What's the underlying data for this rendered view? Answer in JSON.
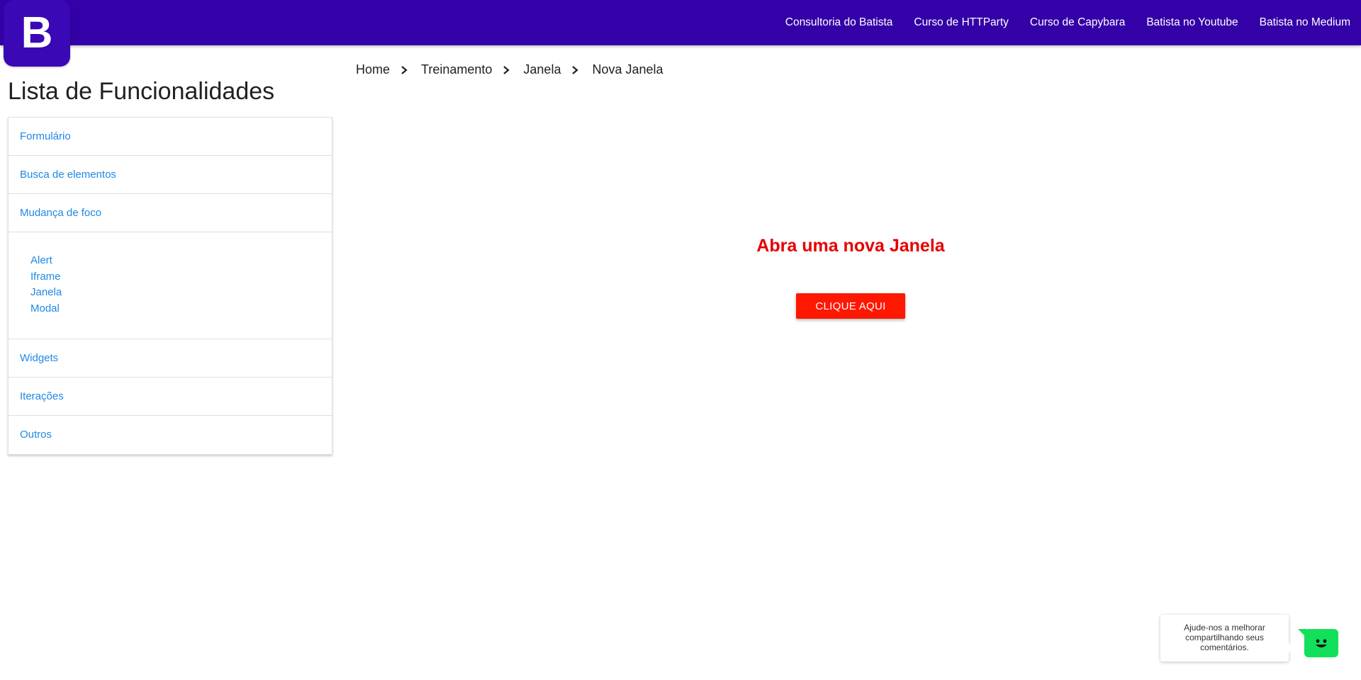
{
  "header": {
    "logo_letter": "B",
    "nav": [
      {
        "label": "Consultoria do Batista"
      },
      {
        "label": "Curso de HTTParty"
      },
      {
        "label": "Curso de Capybara"
      },
      {
        "label": "Batista no Youtube"
      },
      {
        "label": "Batista no Medium"
      }
    ],
    "colors": {
      "bar": "#3400a8",
      "logo": "#3a08b5"
    }
  },
  "sidebar": {
    "title": "Lista de Funcionalidades",
    "items": [
      {
        "label": "Formulário"
      },
      {
        "label": "Busca de elementos"
      },
      {
        "label": "Mudança de foco"
      },
      {
        "label": "Widgets"
      },
      {
        "label": "Iterações"
      },
      {
        "label": "Outros"
      }
    ],
    "subitems": [
      {
        "label": "Alert"
      },
      {
        "label": "Iframe"
      },
      {
        "label": "Janela"
      },
      {
        "label": "Modal"
      }
    ],
    "link_color": "#1e88e5"
  },
  "breadcrumb": {
    "items": [
      {
        "label": "Home"
      },
      {
        "label": "Treinamento"
      },
      {
        "label": "Janela"
      },
      {
        "label": "Nova Janela"
      }
    ],
    "separator_icon": "chevron-right-icon"
  },
  "main": {
    "heading": "Abra uma nova Janela",
    "button_label": "CLIQUE AQUI",
    "heading_color": "#e60000",
    "button_color": "#ff1800"
  },
  "feedback": {
    "text": "Ajude-nos a melhorar compartilhando seus comentários.",
    "chat_icon": "smiley-chat-icon",
    "chat_color": "#13e05a"
  }
}
